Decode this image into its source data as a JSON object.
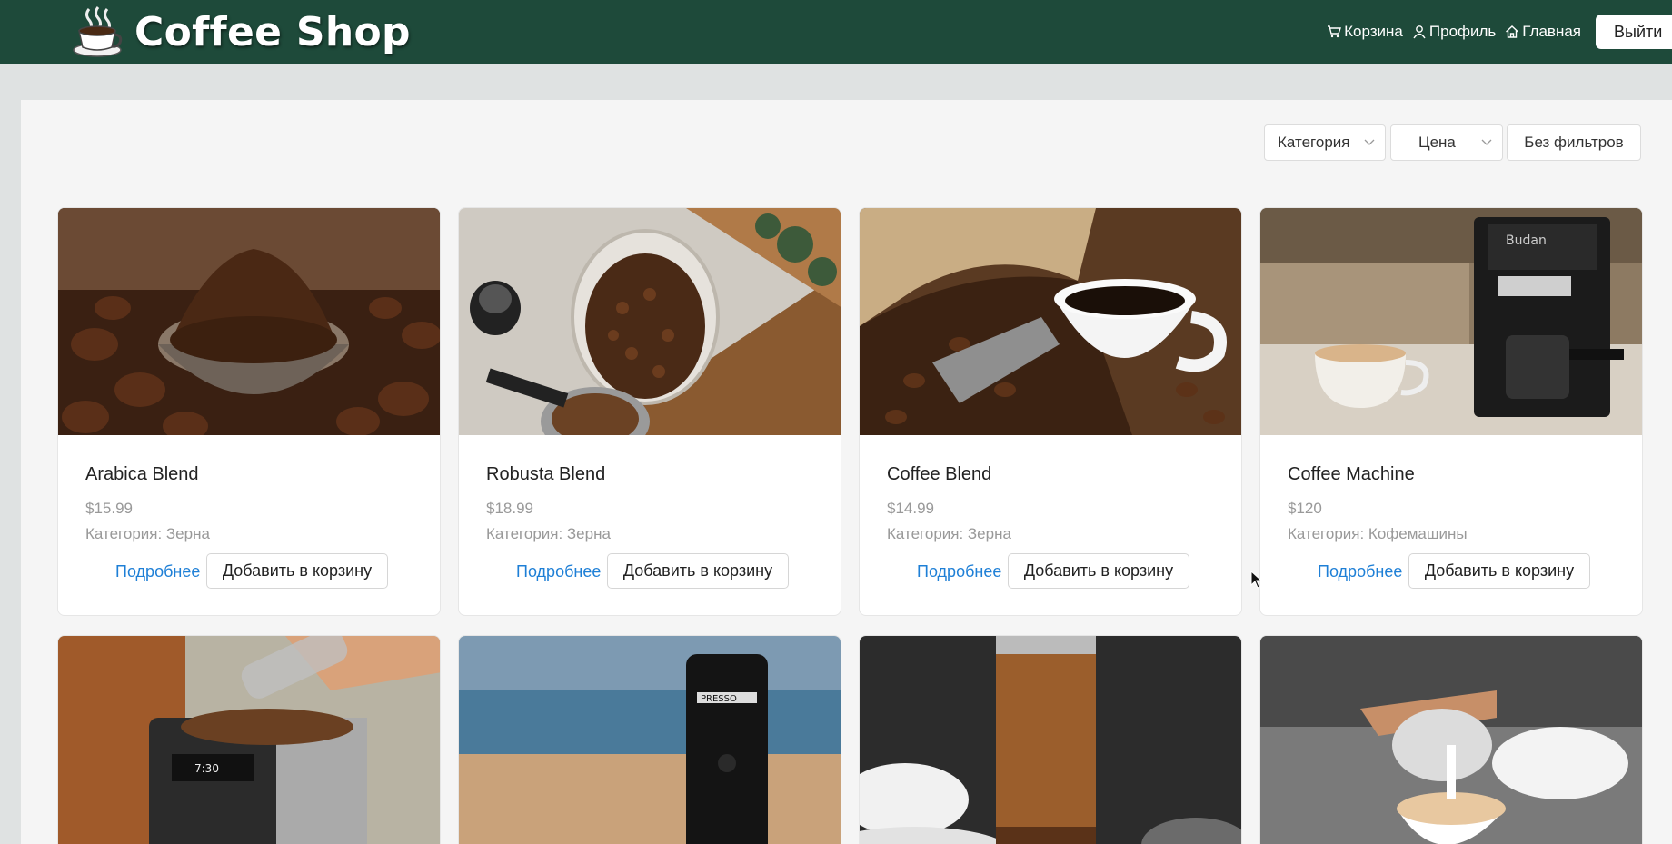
{
  "header": {
    "title": "Coffee Shop",
    "nav": {
      "cart": "Корзина",
      "profile": "Профиль",
      "home": "Главная",
      "logout": "Выйти"
    }
  },
  "filters": {
    "category": "Категория",
    "price": "Цена",
    "reset": "Без фильтров"
  },
  "products": [
    {
      "name": "Arabica Blend",
      "price": "$15.99",
      "category": "Категория: Зерна",
      "details": "Подробнее",
      "add": "Добавить в корзину",
      "image": "coffee-grounds-scoop"
    },
    {
      "name": "Robusta Blend",
      "price": "$18.99",
      "category": "Категория: Зерна",
      "details": "Подробнее",
      "add": "Добавить в корзину",
      "image": "coffee-beans-jar"
    },
    {
      "name": "Coffee Blend",
      "price": "$14.99",
      "category": "Категория: Зерна",
      "details": "Подробнее",
      "add": "Добавить в корзину",
      "image": "coffee-cup-sack"
    },
    {
      "name": "Coffee Machine",
      "price": "$120",
      "category": "Категория: Кофемашины",
      "details": "Подробнее",
      "add": "Добавить в корзину",
      "image": "espresso-machine"
    },
    {
      "image": "bean-grinder-machine"
    },
    {
      "image": "portable-espresso-maker"
    },
    {
      "image": "wooden-hand-grinder"
    },
    {
      "image": "latte-art-pour"
    }
  ],
  "colors": {
    "header_bg": "#1e4a3a",
    "link": "#1e7fd6",
    "muted_text": "#999999",
    "page_bg": "#dfe2e2",
    "panel_bg": "#f5f5f5"
  }
}
